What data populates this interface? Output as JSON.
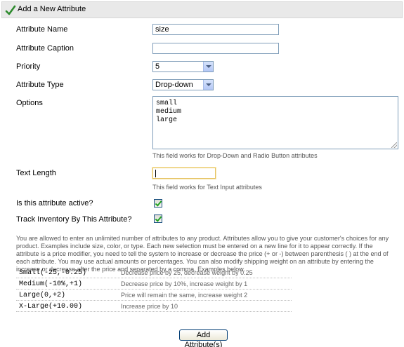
{
  "header": {
    "title": "Add a New Attribute",
    "icon": "check-icon"
  },
  "form": {
    "name": {
      "label": "Attribute Name",
      "value": "size"
    },
    "caption": {
      "label": "Attribute Caption",
      "value": ""
    },
    "priority": {
      "label": "Priority",
      "value": "5"
    },
    "type": {
      "label": "Attribute Type",
      "value": "Drop-down"
    },
    "options": {
      "label": "Options",
      "lines": [
        "small",
        "medium",
        "large"
      ],
      "hint": "This field works for Drop-Down and Radio Button attributes"
    },
    "text_length": {
      "label": "Text Length",
      "value": "",
      "hint": "This field works for Text Input attributes"
    },
    "active": {
      "label": "Is this attribute active?",
      "checked": true
    },
    "track_inventory": {
      "label": "Track Inventory By This Attribute?",
      "checked": true
    }
  },
  "description": "You are allowed to enter an unlimited number of attributes to any product. Attributes allow you to give your customer's choices for any product. Examples include size, color, or type. Each new selection must be entered on a new line for it to appear correctly. If the attribute is a price modifier, you need to tell the system to increase or decrease the price (+ or -) between parenthesis ( ) at the end of each attribute. You may use actual amounts or percentages. You can also modify shipping weight on an attribute by entering the increase or decrease after the price and separated by a comma. Examples below.",
  "examples": [
    {
      "code": "Small(-25,-0.25)",
      "desc": "Decrease price by 25, decrease weight by 0.25"
    },
    {
      "code": "Medium(-10%,+1)",
      "desc": "Decrease price by 10%, increase weight by 1"
    },
    {
      "code": "Large(0,+2)",
      "desc": "Price will remain the same, increase weight 2"
    },
    {
      "code": "X-Large(+10.00)",
      "desc": "Increase price by 10"
    }
  ],
  "submit_label": "Add Attribute(s)"
}
